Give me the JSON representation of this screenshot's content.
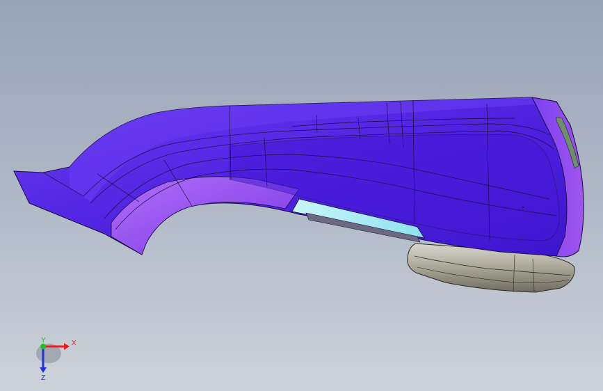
{
  "viewport": {
    "background_top": "#98a3b6",
    "background_bottom": "#cdd2da"
  },
  "model": {
    "body_color": "#5a2ee6",
    "body_dark": "#3a12c8",
    "highlight_color": "#a85cf0",
    "glass_color": "#a8eef6",
    "footrest_color": "#a8a596",
    "edge_color": "#1a1040",
    "trim_green": "#6f8f6a"
  },
  "triad": {
    "x_label": "X",
    "y_label": "Y",
    "z_label": "Z",
    "x_color": "#e82020",
    "y_color": "#20c020",
    "z_color": "#2030d0"
  }
}
